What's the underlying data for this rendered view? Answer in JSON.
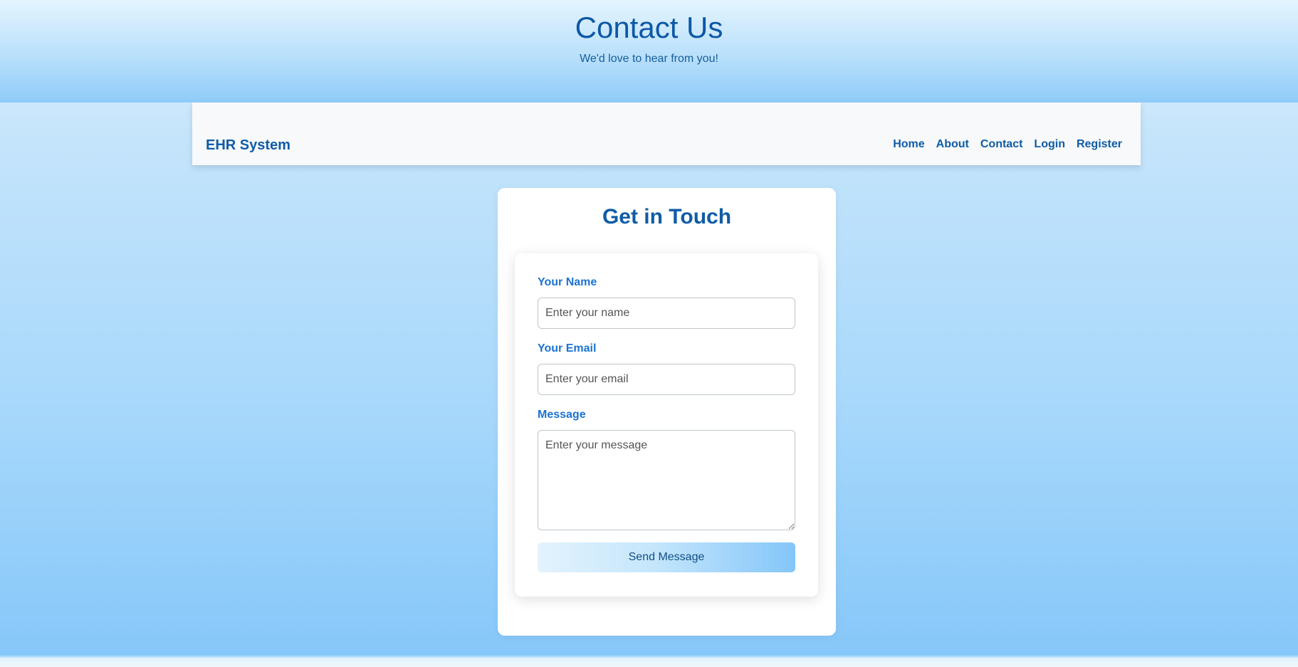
{
  "header": {
    "title": "Contact Us",
    "subtitle": "We'd love to hear from you!"
  },
  "navbar": {
    "brand": "EHR System",
    "links": [
      "Home",
      "About",
      "Contact",
      "Login",
      "Register"
    ]
  },
  "contact_card": {
    "heading": "Get in Touch",
    "name_label": "Your Name",
    "name_placeholder": "Enter your name",
    "name_value": "",
    "email_label": "Your Email",
    "email_placeholder": "Enter your email",
    "email_value": "",
    "message_label": "Message",
    "message_placeholder": "Enter your message",
    "message_value": "",
    "submit_label": "Send Message"
  },
  "colors": {
    "primary": "#0f5ca6",
    "label": "#1b72d3",
    "header_gradient_end": "#8fcbf9"
  }
}
